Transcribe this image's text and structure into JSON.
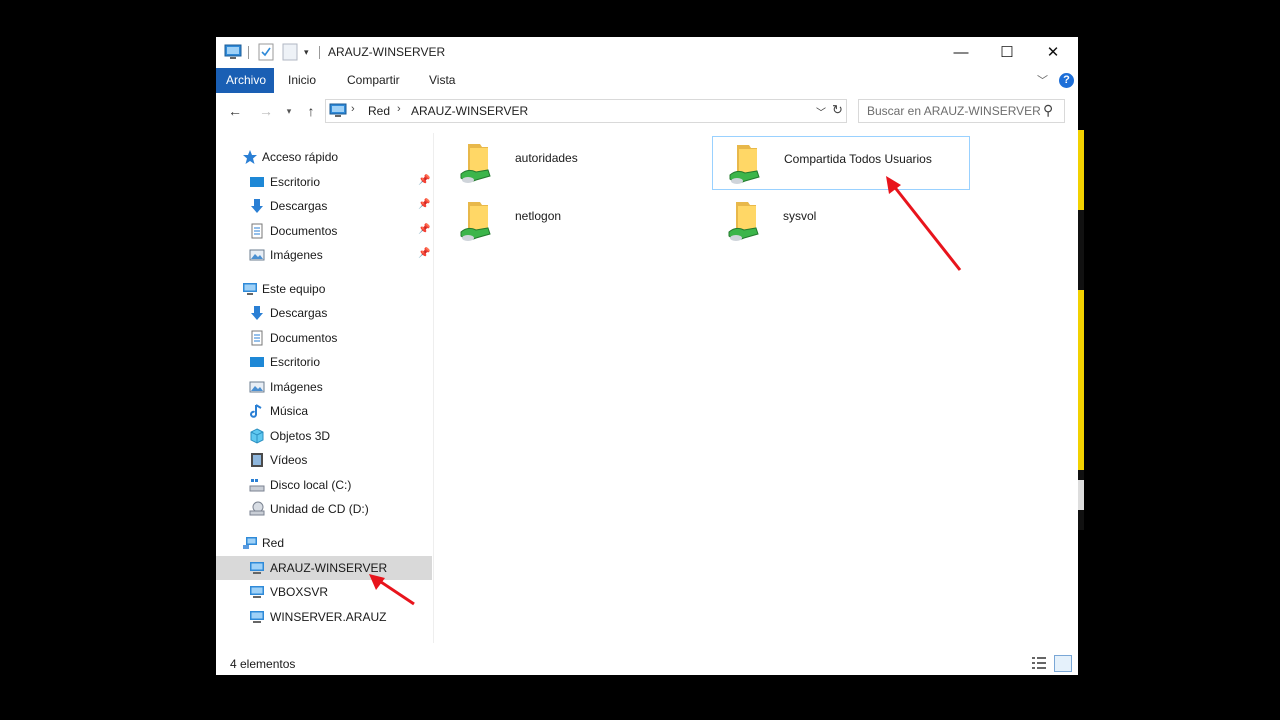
{
  "window": {
    "title": "ARAUZ-WINSERVER",
    "controls": {
      "minimize": "—",
      "maximize": "☐",
      "close": "✕"
    }
  },
  "ribbon": {
    "tabs": [
      "Archivo",
      "Inicio",
      "Compartir",
      "Vista"
    ],
    "active_tab": "Archivo",
    "accent_color": "#1a5fb4"
  },
  "address": {
    "path": [
      "Red",
      "ARAUZ-WINSERVER"
    ],
    "separator": "›",
    "search_placeholder": "Buscar en ARAUZ-WINSERVER"
  },
  "navigation": {
    "quick_access": {
      "label": "Acceso rápido",
      "items": [
        {
          "label": "Escritorio",
          "icon": "desktop-icon",
          "pinned": true
        },
        {
          "label": "Descargas",
          "icon": "downloads-icon",
          "pinned": true
        },
        {
          "label": "Documentos",
          "icon": "documents-icon",
          "pinned": true
        },
        {
          "label": "Imágenes",
          "icon": "pictures-icon",
          "pinned": true
        }
      ]
    },
    "this_pc": {
      "label": "Este equipo",
      "items": [
        {
          "label": "Descargas",
          "icon": "downloads-icon"
        },
        {
          "label": "Documentos",
          "icon": "documents-icon"
        },
        {
          "label": "Escritorio",
          "icon": "desktop-icon"
        },
        {
          "label": "Imágenes",
          "icon": "pictures-icon"
        },
        {
          "label": "Música",
          "icon": "music-icon"
        },
        {
          "label": "Objetos 3D",
          "icon": "objects-3d-icon"
        },
        {
          "label": "Vídeos",
          "icon": "videos-icon"
        },
        {
          "label": "Disco local (C:)",
          "icon": "local-disk-icon"
        },
        {
          "label": "Unidad de CD (D:)",
          "icon": "cd-drive-icon"
        }
      ]
    },
    "network": {
      "label": "Red",
      "items": [
        {
          "label": "ARAUZ-WINSERVER",
          "icon": "computer-icon",
          "selected": true
        },
        {
          "label": "VBOXSVR",
          "icon": "computer-icon"
        },
        {
          "label": "WINSERVER.ARAUZ",
          "icon": "computer-icon"
        }
      ]
    }
  },
  "content": {
    "items": [
      {
        "name": "autoridades",
        "icon": "shared-folder-icon"
      },
      {
        "name": "Compartida Todos  Usuarios",
        "icon": "shared-folder-icon",
        "focused": true
      },
      {
        "name": "netlogon",
        "icon": "shared-folder-icon"
      },
      {
        "name": "sysvol",
        "icon": "shared-folder-icon"
      }
    ]
  },
  "status": {
    "item_count": "4 elementos",
    "view_modes": [
      "details-view-icon",
      "tiles-view-icon"
    ]
  },
  "annotations": {
    "arrow_color": "#e8141c"
  }
}
